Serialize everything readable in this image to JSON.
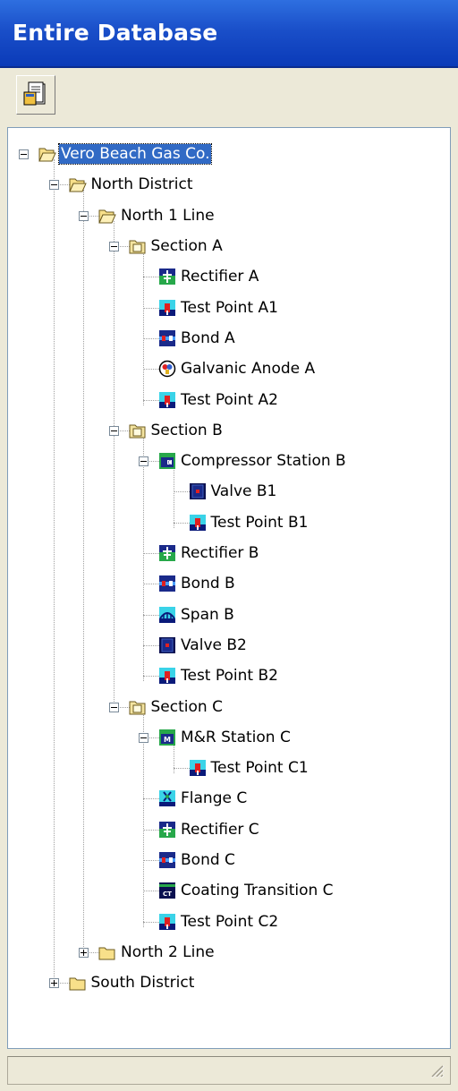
{
  "window": {
    "title": "Entire Database"
  },
  "toolbar": {
    "button_icon": "report-icon"
  },
  "tree": {
    "nodes": [
      {
        "label": "Vero Beach Gas Co.",
        "level": 0,
        "icon": "folder-open",
        "toggle": "minus",
        "selected": true
      },
      {
        "label": "North District",
        "level": 1,
        "icon": "folder-open",
        "toggle": "minus"
      },
      {
        "label": "North 1 Line",
        "level": 2,
        "icon": "folder-open",
        "toggle": "minus"
      },
      {
        "label": "Section A",
        "level": 3,
        "icon": "section-folder",
        "toggle": "minus"
      },
      {
        "label": "Rectifier A",
        "level": 4,
        "icon": "rectifier"
      },
      {
        "label": "Test Point A1",
        "level": 4,
        "icon": "test-point"
      },
      {
        "label": "Bond A",
        "level": 4,
        "icon": "bond"
      },
      {
        "label": "Galvanic Anode A",
        "level": 4,
        "icon": "galvanic-anode"
      },
      {
        "label": "Test Point A2",
        "level": 4,
        "icon": "test-point"
      },
      {
        "label": "Section B",
        "level": 3,
        "icon": "section-folder",
        "toggle": "minus"
      },
      {
        "label": "Compressor Station B",
        "level": 4,
        "icon": "compressor-station",
        "toggle": "minus"
      },
      {
        "label": "Valve B1",
        "level": 5,
        "icon": "valve"
      },
      {
        "label": "Test Point B1",
        "level": 5,
        "icon": "test-point"
      },
      {
        "label": "Rectifier B",
        "level": 4,
        "icon": "rectifier"
      },
      {
        "label": "Bond B",
        "level": 4,
        "icon": "bond"
      },
      {
        "label": "Span B",
        "level": 4,
        "icon": "span"
      },
      {
        "label": "Valve B2",
        "level": 4,
        "icon": "valve"
      },
      {
        "label": "Test Point B2",
        "level": 4,
        "icon": "test-point"
      },
      {
        "label": "Section C",
        "level": 3,
        "icon": "section-folder",
        "toggle": "minus"
      },
      {
        "label": "M&R Station C",
        "level": 4,
        "icon": "mr-station",
        "toggle": "minus"
      },
      {
        "label": "Test Point C1",
        "level": 5,
        "icon": "test-point"
      },
      {
        "label": "Flange C",
        "level": 4,
        "icon": "flange"
      },
      {
        "label": "Rectifier C",
        "level": 4,
        "icon": "rectifier"
      },
      {
        "label": "Bond C",
        "level": 4,
        "icon": "bond"
      },
      {
        "label": "Coating Transition C",
        "level": 4,
        "icon": "coating-transition",
        "icon_text": "CT"
      },
      {
        "label": "Test Point C2",
        "level": 4,
        "icon": "test-point"
      },
      {
        "label": "North 2 Line",
        "level": 2,
        "icon": "folder-closed",
        "toggle": "plus"
      },
      {
        "label": "South District",
        "level": 1,
        "icon": "folder-closed",
        "toggle": "plus"
      }
    ]
  },
  "colors": {
    "titlebar": "#1a4fc9",
    "selection": "#316ac5",
    "chrome": "#ece9d8"
  }
}
